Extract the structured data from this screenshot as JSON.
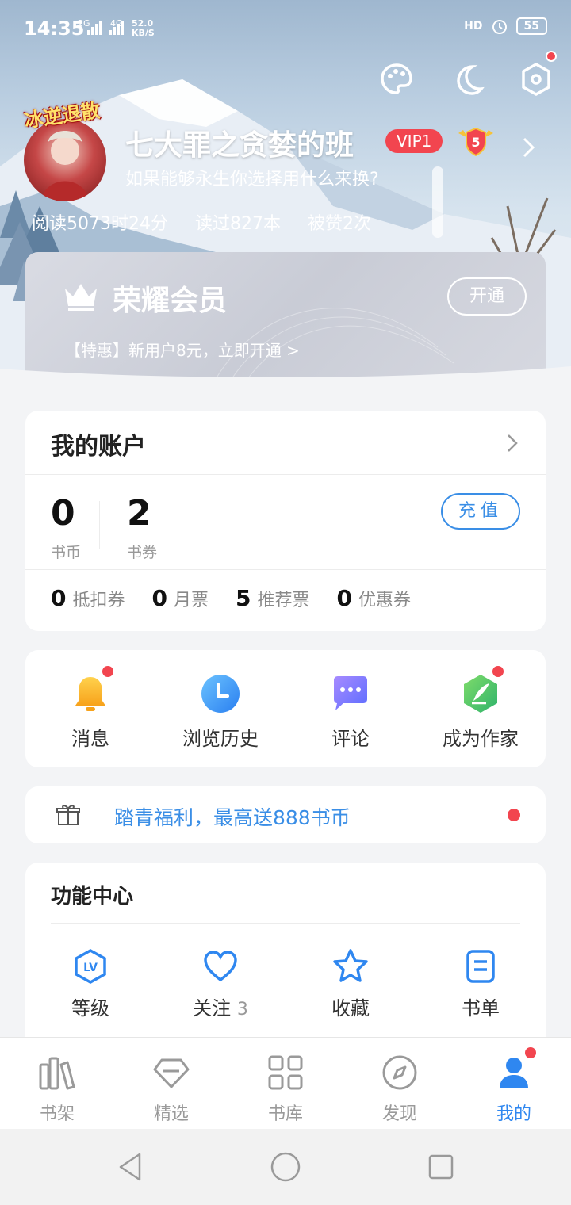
{
  "status_bar": {
    "time": "14:35",
    "net1": "2G",
    "net2": "4G",
    "speed_value": "52.0",
    "speed_unit": "KB/S",
    "battery": "55"
  },
  "profile": {
    "avatar_badge": "冰逆退散",
    "username": "七大罪之贪婪的班",
    "vip_label": "VIP1",
    "level": "5",
    "signature": "如果能够永生你选择用什么来换?",
    "stats": [
      "阅读5073时24分",
      "读过827本",
      "被赞2次"
    ]
  },
  "vip_card": {
    "title": "荣耀会员",
    "promo": "【特惠】新用户8元，立即开通 >",
    "open_button": "开通"
  },
  "account": {
    "title": "我的账户",
    "coins_value": "0",
    "coins_label": "书币",
    "vouchers_value": "2",
    "vouchers_label": "书券",
    "charge_button": "充值",
    "tickets": [
      {
        "value": "0",
        "label": "抵扣券"
      },
      {
        "value": "0",
        "label": "月票"
      },
      {
        "value": "5",
        "label": "推荐票"
      },
      {
        "value": "0",
        "label": "优惠券"
      }
    ]
  },
  "shortcuts": [
    {
      "label": "消息",
      "icon": "bell-icon"
    },
    {
      "label": "浏览历史",
      "icon": "clock-icon"
    },
    {
      "label": "评论",
      "icon": "comment-icon"
    },
    {
      "label": "成为作家",
      "icon": "pen-icon"
    }
  ],
  "promo_bar": {
    "text": "踏青福利，最高送888书币"
  },
  "features": {
    "title": "功能中心",
    "items": [
      {
        "label": "等级",
        "count": ""
      },
      {
        "label": "关注",
        "count": "3"
      },
      {
        "label": "收藏",
        "count": ""
      },
      {
        "label": "书单",
        "count": ""
      }
    ]
  },
  "bottom_nav": [
    {
      "label": "书架"
    },
    {
      "label": "精选"
    },
    {
      "label": "书库"
    },
    {
      "label": "发现"
    },
    {
      "label": "我的",
      "active": true
    }
  ],
  "colors": {
    "accent": "#3a8ee6",
    "red": "#f2454f",
    "active_tab": "#2f87f0"
  }
}
